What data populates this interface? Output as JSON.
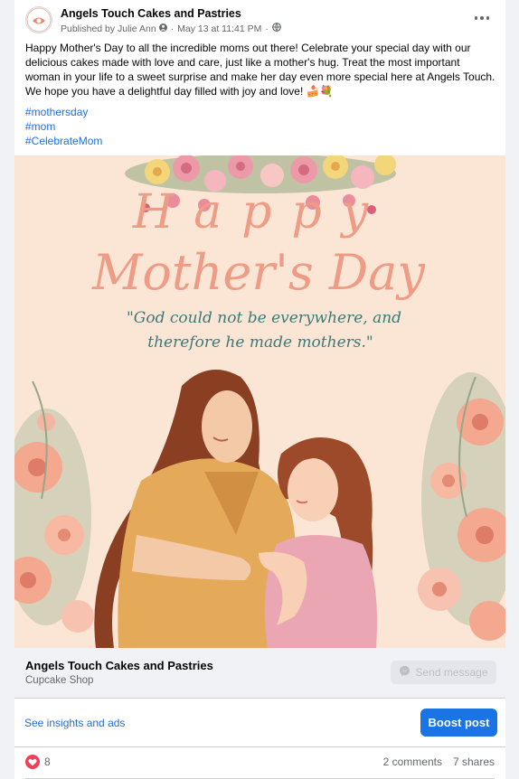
{
  "post": {
    "page_name": "Angels Touch Cakes and Pastries",
    "published_by": "Published by Julie Ann",
    "date": "May 13 at 11:41 PM",
    "text_lines": [
      "Happy Mother's Day to all the incredible moms out there! Celebrate your special day with our",
      "delicious cakes made with love and care, just like a mother's hug. Treat the most important",
      "woman in your life to a sweet surprise and make her day even more special here at Angels Touch.",
      "We hope you have a delightful day filled with joy and love! 🍰💐"
    ],
    "hashtags": [
      "#mothersday",
      "#mom",
      "#CelebrateMom"
    ]
  },
  "image": {
    "headline": "Happy",
    "subheadline": "Mother's Day",
    "quote_line1": "\"God could not be everywhere, and",
    "quote_line2": "therefore he made mothers.\""
  },
  "page_strip": {
    "name": "Angels Touch Cakes and Pastries",
    "category": "Cupcake Shop",
    "send_label": "Send message"
  },
  "actions": {
    "insights_label": "See insights and ads",
    "boost_label": "Boost post"
  },
  "stats": {
    "reaction_count": "8",
    "comments": "2 comments",
    "shares": "7 shares"
  },
  "colors": {
    "link": "#216fdb",
    "boost": "#1b74e4",
    "love": "#f33e58",
    "image_bg": "#fbe6d6",
    "headline": "#ee9c85",
    "quote": "#3c7a78"
  },
  "icons": [
    "more-options-icon",
    "globe-icon",
    "profile-verified-icon",
    "messenger-icon",
    "love-reaction-icon"
  ]
}
